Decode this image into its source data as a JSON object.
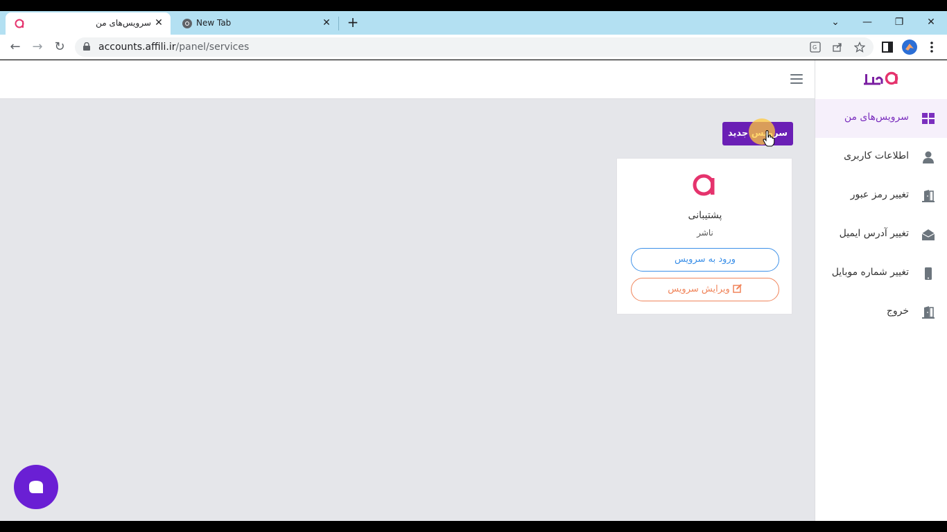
{
  "browser": {
    "tabs": [
      {
        "title": "سرویس‌های من",
        "active": true
      },
      {
        "title": "New Tab",
        "active": false
      }
    ],
    "url_host": "accounts.affili.ir",
    "url_path": "/panel/services"
  },
  "sidebar": {
    "items": [
      {
        "label": "سرویس‌های من",
        "icon": "grid-icon",
        "active": true
      },
      {
        "label": "اطلاعات کاربری",
        "icon": "user-icon",
        "active": false
      },
      {
        "label": "تغییر رمز عبور",
        "icon": "door-icon",
        "active": false
      },
      {
        "label": "تغییر آدرس ایمیل",
        "icon": "envelope-open-icon",
        "active": false
      },
      {
        "label": "تغییر شماره موبایل",
        "icon": "mobile-icon",
        "active": false
      },
      {
        "label": "خروج",
        "icon": "door-icon",
        "active": false
      }
    ]
  },
  "main": {
    "new_service_label": "سرویس جدید",
    "card": {
      "title": "پشتیبانی",
      "subtitle": "ناشر",
      "enter_label": "ورود به سرویس",
      "edit_label": "ویرایش سرویس"
    }
  },
  "colors": {
    "brand_purple": "#6a1fb5",
    "brand_pink": "#e5336d",
    "enter_blue": "#3a8fe8",
    "edit_orange": "#f0845a"
  }
}
